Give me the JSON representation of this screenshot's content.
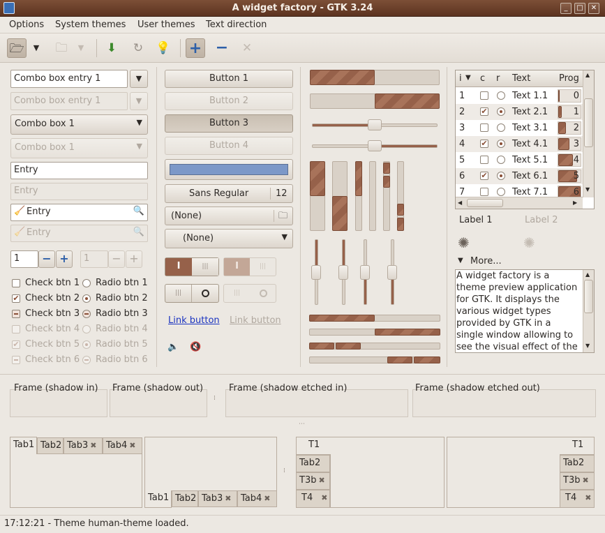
{
  "window": {
    "title": "A widget factory - GTK 3.24"
  },
  "menu": [
    "Options",
    "System themes",
    "User themes",
    "Text direction"
  ],
  "col1": {
    "combo_entry1": "Combo box entry 1",
    "combo1": "Combo box 1",
    "entry": "Entry",
    "spin_value": "1",
    "checks": [
      "Check btn 1",
      "Check btn 2",
      "Check btn 3",
      "Check btn 4",
      "Check btn 5",
      "Check btn 6"
    ],
    "radios": [
      "Radio btn 1",
      "Radio btn 2",
      "Radio btn 3",
      "Radio btn 4",
      "Radio btn 5",
      "Radio btn 6"
    ]
  },
  "col2": {
    "buttons": [
      "Button 1",
      "Button 2",
      "Button 3",
      "Button 4"
    ],
    "color_swatch": "#7c98c8",
    "font_name": "Sans Regular",
    "font_size": "12",
    "file_chooser": "(None)",
    "combo_none": "(None)",
    "link": "Link button"
  },
  "col3": {
    "scales": [
      0.52,
      0.52
    ],
    "progress": [
      0.5,
      1.0,
      0.5
    ]
  },
  "tree": {
    "headers": [
      "i",
      "c",
      "r",
      "Text",
      "Prog"
    ],
    "rows": [
      {
        "i": "1",
        "text": "Text 1.1",
        "prog": "0",
        "c": false,
        "r": false
      },
      {
        "i": "2",
        "text": "Text 2.1",
        "prog": "1",
        "c": true,
        "r": true
      },
      {
        "i": "3",
        "text": "Text 3.1",
        "prog": "2",
        "c": false,
        "r": false
      },
      {
        "i": "4",
        "text": "Text 4.1",
        "prog": "3",
        "c": true,
        "r": true
      },
      {
        "i": "5",
        "text": "Text 5.1",
        "prog": "4",
        "c": false,
        "r": false
      },
      {
        "i": "6",
        "text": "Text 6.1",
        "prog": "5",
        "c": true,
        "r": true
      },
      {
        "i": "7",
        "text": "Text 7.1",
        "prog": "6",
        "c": false,
        "r": false
      }
    ]
  },
  "labels": {
    "label1": "Label 1",
    "label2": "Label 2",
    "expander": "More..."
  },
  "textview": "A widget factory is a theme preview application for GTK. It displays the various widget types provided by GTK in a single window allowing to see the visual effect of the",
  "frames": [
    "Frame (shadow in)",
    "Frame (shadow out)",
    "Frame (shadow etched in)",
    "Frame (shadow etched out)"
  ],
  "tabs": {
    "top": [
      "Tab1",
      "Tab2",
      "Tab3",
      "Tab4"
    ],
    "side": [
      "T1",
      "Tab2",
      "T3b",
      "T4"
    ]
  },
  "status": "17:12:21 - Theme human-theme loaded.",
  "colors": {
    "accent": "#96614a",
    "title": "#6b4330",
    "link": "#1a33c0"
  }
}
